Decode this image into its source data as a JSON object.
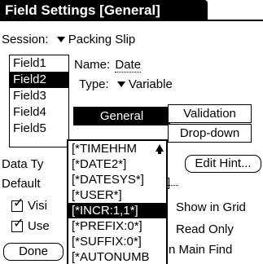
{
  "title": "Field Settings [General]",
  "session": {
    "label": "Session:",
    "value": "Packing Slip"
  },
  "fields": [
    "Field1",
    "Field2",
    "Field3",
    "Field4",
    "Field5"
  ],
  "selected_field_index": 1,
  "name": {
    "label": "Name:",
    "value": "Date"
  },
  "type": {
    "label": "Type:",
    "value": "Variable"
  },
  "tabs": [
    "General",
    "Validation",
    "Drop-down"
  ],
  "data_type_label": "Data Ty",
  "default_label": "Default",
  "edit_hint_button": "Edit Hint...",
  "checkboxes": [
    {
      "label": "Visi",
      "checked": true
    },
    {
      "label": "Use",
      "checked": true
    }
  ],
  "right_options": [
    "Show in Grid",
    "Read Only",
    "n Main Find"
  ],
  "done_button": "Done",
  "popup_items": [
    "[*TIMEHHM",
    "[*DATE2*]",
    "[*DATESYS*]",
    "[*USER*]",
    "[*INCR:1,1*]",
    "[*PREFIX:0*]",
    "[*SUFFIX:0*]",
    "[*AUTONUMB"
  ],
  "popup_selected_index": 4,
  "icons": {
    "dropdown": "triangle-down-icon",
    "scroll_up": "arrow-up-icon",
    "check": "checkmark-icon"
  }
}
